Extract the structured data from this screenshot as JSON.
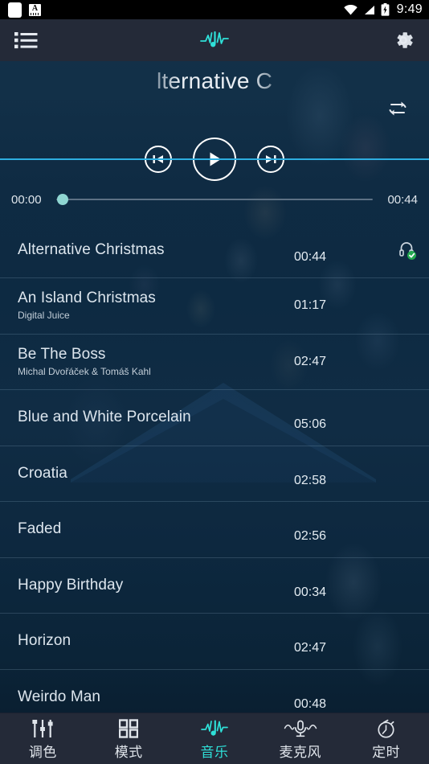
{
  "statusbar": {
    "time": "9:49",
    "icons": [
      "white-square-icon",
      "font-size-a-icon",
      "wifi-icon",
      "cellular-signal-icon",
      "battery-charging-icon"
    ]
  },
  "toolbar": {
    "list_icon": "list-icon",
    "logo_icon": "music-waveform-logo-icon",
    "settings_icon": "gear-icon"
  },
  "player": {
    "track_title": "lternative C",
    "repeat_icon": "repeat-icon",
    "previous_icon": "skip-previous-icon",
    "play_icon": "play-icon",
    "next_icon": "skip-next-icon",
    "elapsed": "00:00",
    "duration": "00:44",
    "progress_percent": 0,
    "accent_color": "#2fe0d8",
    "thumb_color": "#8fd6d2",
    "divider_color": "#2eaee0"
  },
  "songs": [
    {
      "title": "Alternative Christmas",
      "artist": "",
      "duration": "00:44",
      "flag_icon": "headphone-check-icon",
      "selected": true
    },
    {
      "title": "An Island Christmas",
      "artist": "Digital Juice",
      "duration": "01:17",
      "flag_icon": "",
      "selected": false
    },
    {
      "title": "Be The Boss",
      "artist": "Michal Dvořáček & Tomáš Kahl",
      "duration": "02:47",
      "flag_icon": "",
      "selected": false
    },
    {
      "title": "Blue and White Porcelain",
      "artist": "",
      "duration": "05:06",
      "flag_icon": "",
      "selected": false
    },
    {
      "title": "Croatia",
      "artist": "",
      "duration": "02:58",
      "flag_icon": "",
      "selected": false
    },
    {
      "title": "Faded",
      "artist": "",
      "duration": "02:56",
      "flag_icon": "",
      "selected": false
    },
    {
      "title": "Happy Birthday",
      "artist": "",
      "duration": "00:34",
      "flag_icon": "",
      "selected": false
    },
    {
      "title": "Horizon",
      "artist": "",
      "duration": "02:47",
      "flag_icon": "",
      "selected": false
    },
    {
      "title": "Weirdo Man",
      "artist": "",
      "duration": "00:48",
      "flag_icon": "",
      "selected": false
    }
  ],
  "bottomnav": {
    "items": [
      {
        "label": "调色",
        "icon": "equalizer-sliders-icon",
        "active": false
      },
      {
        "label": "模式",
        "icon": "grid-squares-icon",
        "active": false
      },
      {
        "label": "音乐",
        "icon": "music-waveform-icon",
        "active": true
      },
      {
        "label": "麦克风",
        "icon": "microphone-icon",
        "active": false
      },
      {
        "label": "定时",
        "icon": "stopwatch-icon",
        "active": false
      }
    ]
  }
}
